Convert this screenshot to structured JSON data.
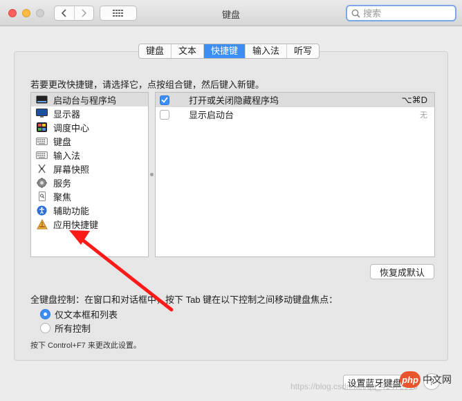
{
  "window": {
    "title": "键盘",
    "search_placeholder": "搜索"
  },
  "tabs": [
    {
      "label": "键盘",
      "active": false
    },
    {
      "label": "文本",
      "active": false
    },
    {
      "label": "快捷键",
      "active": true
    },
    {
      "label": "输入法",
      "active": false
    },
    {
      "label": "听写",
      "active": false
    }
  ],
  "instruction": "若要更改快捷键，请选择它，点按组合键，然后键入新键。",
  "categories": [
    {
      "label": "启动台与程序坞",
      "icon": "launchpad-dock-icon",
      "selected": true
    },
    {
      "label": "显示器",
      "icon": "display-icon",
      "selected": false
    },
    {
      "label": "调度中心",
      "icon": "mission-control-icon",
      "selected": false
    },
    {
      "label": "键盘",
      "icon": "keyboard-icon",
      "selected": false
    },
    {
      "label": "输入法",
      "icon": "input-method-icon",
      "selected": false
    },
    {
      "label": "屏幕快照",
      "icon": "screenshot-icon",
      "selected": false
    },
    {
      "label": "服务",
      "icon": "services-gear-icon",
      "selected": false
    },
    {
      "label": "聚焦",
      "icon": "spotlight-icon",
      "selected": false
    },
    {
      "label": "辅助功能",
      "icon": "accessibility-icon",
      "selected": false
    },
    {
      "label": "应用快捷键",
      "icon": "app-shortcuts-icon",
      "selected": false
    }
  ],
  "shortcuts": [
    {
      "label": "打开或关闭隐藏程序坞",
      "keys": "⌥⌘D",
      "checked": true,
      "selected": true
    },
    {
      "label": "显示启动台",
      "keys": "无",
      "checked": false,
      "selected": false
    }
  ],
  "restore_defaults_label": "恢复成默认",
  "full_keyboard_access": {
    "label": "全键盘控制：在窗口和对话框中，按下 Tab 键在以下控制之间移动键盘焦点：",
    "options": [
      {
        "label": "仅文本框和列表",
        "selected": true
      },
      {
        "label": "所有控制",
        "selected": false
      }
    ],
    "hint": "按下 Control+F7 来更改此设置。"
  },
  "bluetooth_button_label": "设置蓝牙键盘…",
  "help_label": "?",
  "watermark": "https://blog.csdn.net/qq_41475919",
  "site_badge": {
    "logo": "php",
    "text": "中文网"
  },
  "colors": {
    "accent": "#3d8ef4",
    "arrow": "#ff1a1a"
  }
}
